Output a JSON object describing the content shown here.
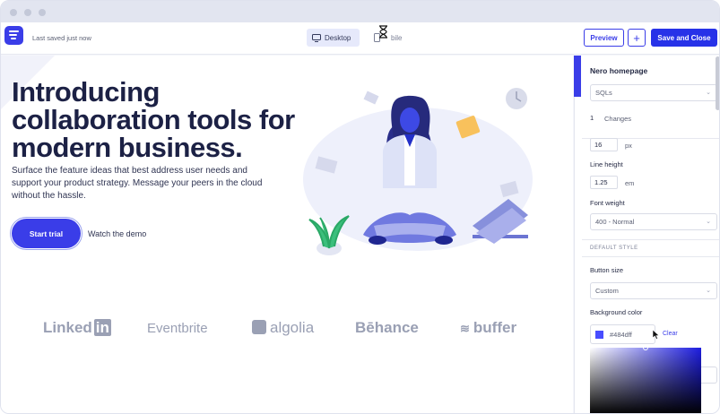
{
  "topbar": {
    "saved_status": "Last saved just now",
    "view_desktop": "Desktop",
    "view_mobile": "bile",
    "preview_label": "Preview",
    "add_label": "+",
    "save_label": "Save and Close"
  },
  "hero": {
    "title": "Introducing collaboration tools for modern business.",
    "subtitle": "Surface the feature ideas that best address user needs and support your product strategy. Message your peers in the cloud without the hassle.",
    "cta_primary": "Start trial",
    "cta_secondary": "Watch the demo"
  },
  "logos": [
    "Linked",
    "in",
    "Eventbrite",
    "algolia",
    "Bēhance",
    "buffer"
  ],
  "panel": {
    "page_name": "Nero homepage",
    "page_select": "SQLs",
    "changes_count": "1",
    "changes_label": "Changes",
    "font_size_value": "16",
    "font_size_unit": "px",
    "line_height_label": "Line height",
    "line_height_value": "1.25",
    "line_height_unit": "em",
    "font_weight_label": "Font weight",
    "font_weight_value": "400 - Normal",
    "section_default_style": "DEFAULT STYLE",
    "button_size_label": "Button size",
    "button_size_value": "Custom",
    "bg_color_label": "Background color",
    "bg_color_value": "#484dff",
    "clear_label": "Clear"
  },
  "colors": {
    "accent": "#3a3de8",
    "save_button": "#2732e8",
    "heading": "#1c2145",
    "swatch": "#484dff"
  },
  "icons": {
    "logo": "sidebar-logo-icon",
    "desktop": "monitor-icon",
    "mobile": "phone-icon",
    "loading": "hourglass-icon",
    "chevron": "chevron-down-icon"
  }
}
